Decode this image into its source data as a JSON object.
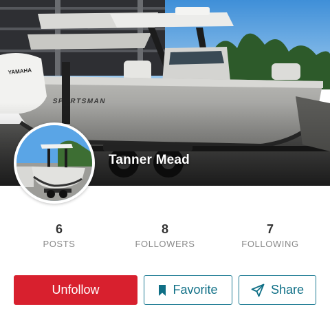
{
  "profile": {
    "name": "Tanner Mead",
    "cover_boat_brand": "SPORTSMAN",
    "engine_brand": "YAMAHA"
  },
  "stats": [
    {
      "value": "6",
      "label": "POSTS"
    },
    {
      "value": "8",
      "label": "FOLLOWERS"
    },
    {
      "value": "7",
      "label": "FOLLOWING"
    }
  ],
  "actions": {
    "unfollow_label": "Unfollow",
    "favorite_label": "Favorite",
    "share_label": "Share"
  },
  "icons": {
    "favorite": "bookmark-icon",
    "share": "paper-plane-icon"
  },
  "colors": {
    "primary_red": "#d8202e",
    "accent_teal": "#1f7c94",
    "stat_label": "#8a8a8a"
  }
}
